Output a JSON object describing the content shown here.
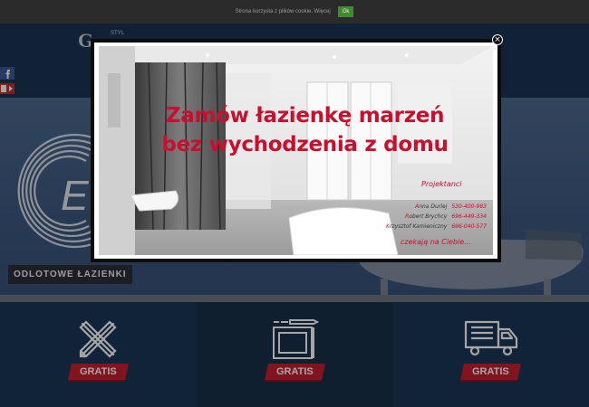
{
  "cookie": {
    "text": "Strona korzysta z plików cookie. Więcej",
    "ok_label": "Ok"
  },
  "header": {
    "logo_letter": "G",
    "logo_sub": "STYL"
  },
  "hero": {
    "caption": "ODLOTOWE ŁAZIENKI",
    "logo_letter": "E"
  },
  "services": [
    {
      "icon": "pencil-ruler-icon",
      "badge": "GRATIS"
    },
    {
      "icon": "blueprint-icon",
      "badge": "GRATIS"
    },
    {
      "icon": "delivery-truck-icon",
      "badge": "GRATIS"
    }
  ],
  "modal": {
    "headline_line1": "Zamów łazienkę marzeń",
    "headline_line2": "bez wychodzenia z domu",
    "projektanci_label": "Projektanci",
    "contacts": [
      {
        "name": "Anna Durlej",
        "phone": "530-400-983"
      },
      {
        "name": "Robert Brychcy",
        "phone": "696-449-334"
      },
      {
        "name": "Krzysztof Kamieniczny",
        "phone": "696-040-577"
      }
    ],
    "footer": "czekają na Ciebie...",
    "close_glyph": "×"
  },
  "colors": {
    "accent_red": "#c8102e",
    "header_blue": "#1b3554",
    "cookie_green": "#3e8a2e"
  }
}
